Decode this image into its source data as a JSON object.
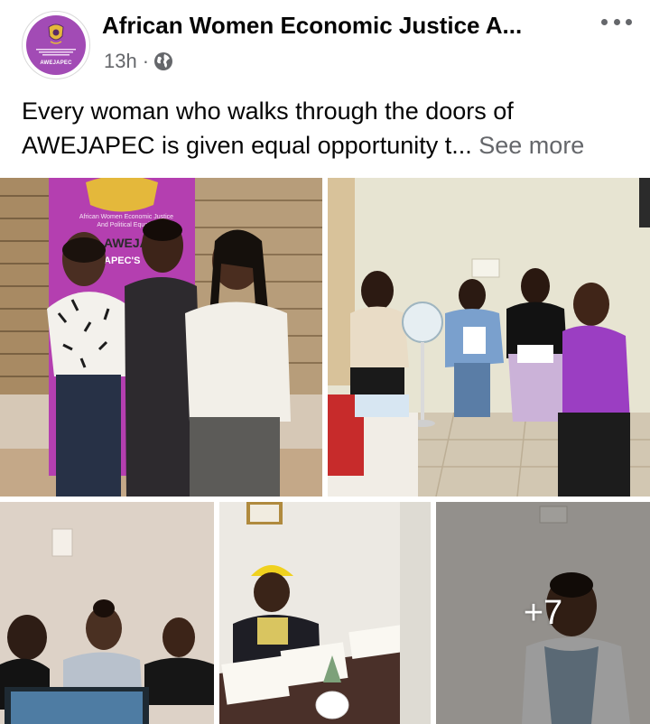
{
  "post": {
    "page_name": "African Women Economic Justice A...",
    "time_ago": "13h",
    "separator": "·",
    "audience_icon": "globe-icon",
    "more_icon": "three-dots-icon",
    "avatar": {
      "logo_name": "AWEJAPEC",
      "colors": {
        "purple": "#a24bb5",
        "gold": "#e4b83b"
      }
    },
    "text_line1": "Every woman who walks through the doors of",
    "text_line2": "AWEJAPEC is given equal opportunity t...",
    "see_more_label": "See more"
  },
  "photos": {
    "banner_line1": "African Women Economic Justice",
    "banner_line2": "And Political Equality",
    "banner_line3": "AWEJAP",
    "banner_line4": "APEC'S",
    "extra_count": "+7"
  },
  "colors": {
    "text_primary": "#050505",
    "text_secondary": "#65676b",
    "banner_purple": "#b43fb0"
  }
}
